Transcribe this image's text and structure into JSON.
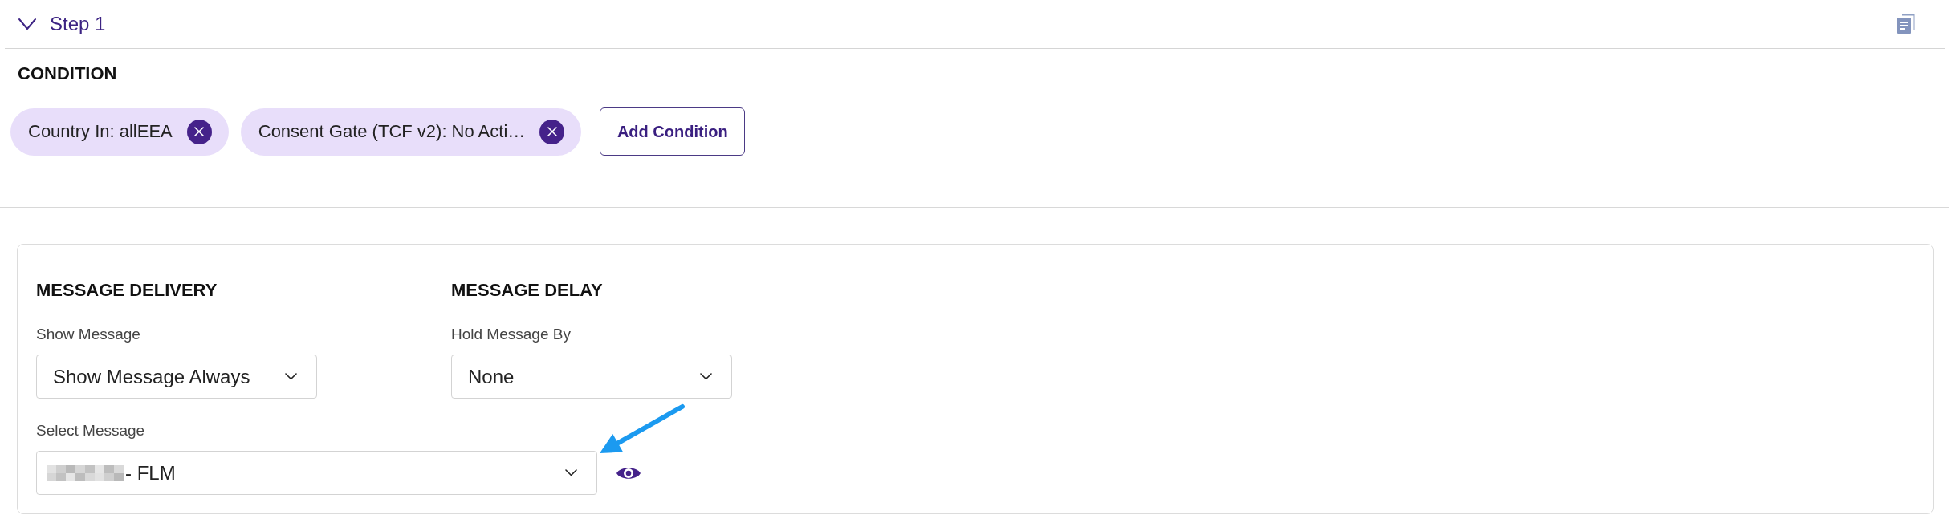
{
  "step": {
    "title": "Step 1",
    "expanded": true
  },
  "condition": {
    "heading": "CONDITION",
    "chips": [
      {
        "label": "Country In: allEEA"
      },
      {
        "label": "Consent Gate (TCF v2): No Acti…"
      }
    ],
    "add_button": "Add Condition"
  },
  "message_delivery": {
    "heading": "MESSAGE DELIVERY",
    "show_message": {
      "label": "Show Message",
      "value": "Show Message Always"
    },
    "select_message": {
      "label": "Select Message",
      "value": "- FLM",
      "redacted": true
    }
  },
  "message_delay": {
    "heading": "MESSAGE DELAY",
    "hold_message_by": {
      "label": "Hold Message By",
      "value": "None"
    }
  }
}
